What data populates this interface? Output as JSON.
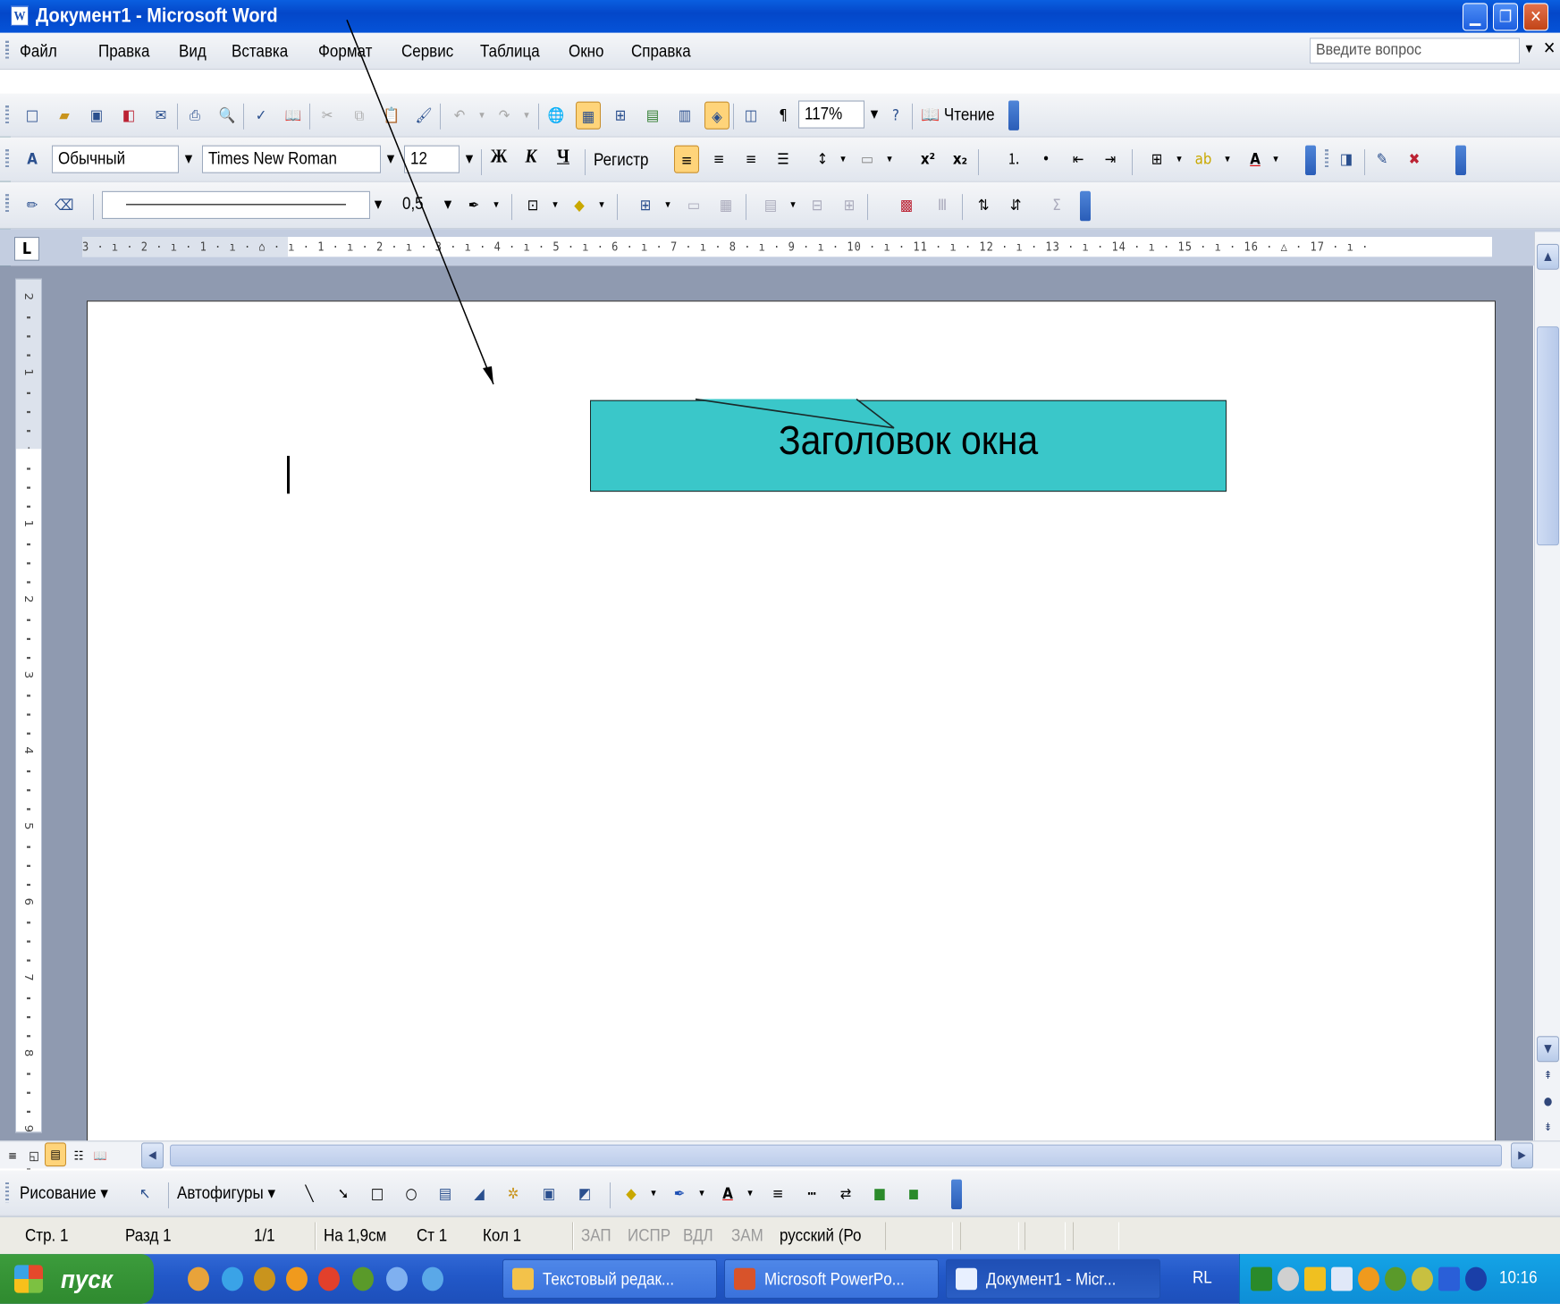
{
  "titlebar": {
    "title": "Документ1 - Microsoft Word",
    "app_icon_letter": "W"
  },
  "window_buttons": [
    "minimize-icon",
    "maximize-icon",
    "close-icon"
  ],
  "menu": {
    "items": [
      "Файл",
      "Правка",
      "Вид",
      "Вставка",
      "Формат",
      "Сервис",
      "Таблица",
      "Окно",
      "Справка"
    ],
    "ask_placeholder": "Введите вопрос"
  },
  "standard_toolbar": {
    "zoom": "117%",
    "reading_label": "Чтение"
  },
  "formatting_toolbar": {
    "style": "Обычный",
    "font": "Times New Roman",
    "size": "12",
    "bold": "Ж",
    "italic": "К",
    "underline": "Ч",
    "register": "Регистр"
  },
  "drawing_line_toolbar": {
    "line_weight": "0,5"
  },
  "ruler": {
    "tab_selector": "L",
    "scale_text": "3 · ı · 2 · ı · 1 · ı · ⌂ · ı · 1 · ı · 2 · ı · 3 · ı · 4 · ı · 5 · ı · 6 · ı · 7 · ı · 8 · ı · 9 · ı · 10 · ı · 11 · ı · 12 · ı · 13 · ı · 14 · ı · 15 · ı · 16 · △ · 17 · ı ·"
  },
  "vertical_ruler": {
    "marks": [
      "2",
      "1",
      "",
      "1",
      "2",
      "3",
      "4",
      "5",
      "6",
      "7",
      "8",
      "9"
    ]
  },
  "callout": {
    "text": "Заголовок окна",
    "color": "#3ac7c9"
  },
  "drawing_toolbar": {
    "draw_label": "Рисование",
    "autoshapes_label": "Автофигуры"
  },
  "statusbar": {
    "page": "Стр. 1",
    "section": "Разд 1",
    "pages": "1/1",
    "at": "На 1,9см",
    "line": "Ст 1",
    "col": "Кол 1",
    "rec": "ЗАП",
    "trk": "ИСПР",
    "ext": "ВДЛ",
    "ovr": "ЗАМ",
    "lang": "русский (Ро"
  },
  "taskbar": {
    "start_label": "пуск",
    "buttons": [
      "Текстовый редак...",
      "Microsoft PowerPo...",
      "Документ1 - Micr..."
    ],
    "lang": "RL",
    "clock": "10:16"
  },
  "colors": {
    "title_blue": "#0553d8",
    "start_green": "#2f8a2f",
    "tray_blue": "#0e8ed6"
  }
}
